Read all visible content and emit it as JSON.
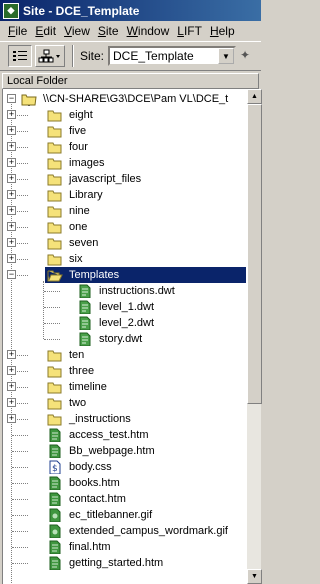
{
  "window": {
    "title": "Site - DCE_Template"
  },
  "menu": [
    "File",
    "Edit",
    "View",
    "Site",
    "Window",
    "LIFT",
    "Help"
  ],
  "toolbar": {
    "site_label": "Site:",
    "site_value": "DCE_Template"
  },
  "panel": {
    "header": "Local Folder"
  },
  "tree": {
    "root": "\\\\CN-SHARE\\G3\\DCE\\Pam VL\\DCE_t",
    "items": [
      {
        "label": "eight",
        "kind": "folder",
        "level": 1,
        "expander": "+"
      },
      {
        "label": "five",
        "kind": "folder",
        "level": 1,
        "expander": "+"
      },
      {
        "label": "four",
        "kind": "folder",
        "level": 1,
        "expander": "+"
      },
      {
        "label": "images",
        "kind": "folder",
        "level": 1,
        "expander": "+"
      },
      {
        "label": "javascript_files",
        "kind": "folder",
        "level": 1,
        "expander": "+"
      },
      {
        "label": "Library",
        "kind": "folder",
        "level": 1,
        "expander": "+"
      },
      {
        "label": "nine",
        "kind": "folder",
        "level": 1,
        "expander": "+"
      },
      {
        "label": "one",
        "kind": "folder",
        "level": 1,
        "expander": "+"
      },
      {
        "label": "seven",
        "kind": "folder",
        "level": 1,
        "expander": "+"
      },
      {
        "label": "six",
        "kind": "folder",
        "level": 1,
        "expander": "+"
      },
      {
        "label": "Templates",
        "kind": "folder-open",
        "level": 1,
        "expander": "-",
        "selected": true
      },
      {
        "label": "instructions.dwt",
        "kind": "template",
        "level": 2
      },
      {
        "label": "level_1.dwt",
        "kind": "template",
        "level": 2
      },
      {
        "label": "level_2.dwt",
        "kind": "template",
        "level": 2
      },
      {
        "label": "story.dwt",
        "kind": "template",
        "level": 2
      },
      {
        "label": "ten",
        "kind": "folder",
        "level": 1,
        "expander": "+"
      },
      {
        "label": "three",
        "kind": "folder",
        "level": 1,
        "expander": "+"
      },
      {
        "label": "timeline",
        "kind": "folder",
        "level": 1,
        "expander": "+"
      },
      {
        "label": "two",
        "kind": "folder",
        "level": 1,
        "expander": "+"
      },
      {
        "label": "_instructions",
        "kind": "folder",
        "level": 1,
        "expander": "+"
      },
      {
        "label": "access_test.htm",
        "kind": "html",
        "level": 1
      },
      {
        "label": "Bb_webpage.htm",
        "kind": "html",
        "level": 1
      },
      {
        "label": "body.css",
        "kind": "css",
        "level": 1
      },
      {
        "label": "books.htm",
        "kind": "html",
        "level": 1
      },
      {
        "label": "contact.htm",
        "kind": "html",
        "level": 1
      },
      {
        "label": "ec_titlebanner.gif",
        "kind": "image",
        "level": 1
      },
      {
        "label": "extended_campus_wordmark.gif",
        "kind": "image",
        "level": 1
      },
      {
        "label": "final.htm",
        "kind": "html",
        "level": 1
      },
      {
        "label": "getting_started.htm",
        "kind": "html",
        "level": 1
      }
    ]
  },
  "colors": {
    "titlebar": "#0a246a",
    "selection": "#0a246a",
    "folder": "#f5e27a",
    "file_green": "#2f8a2f"
  }
}
